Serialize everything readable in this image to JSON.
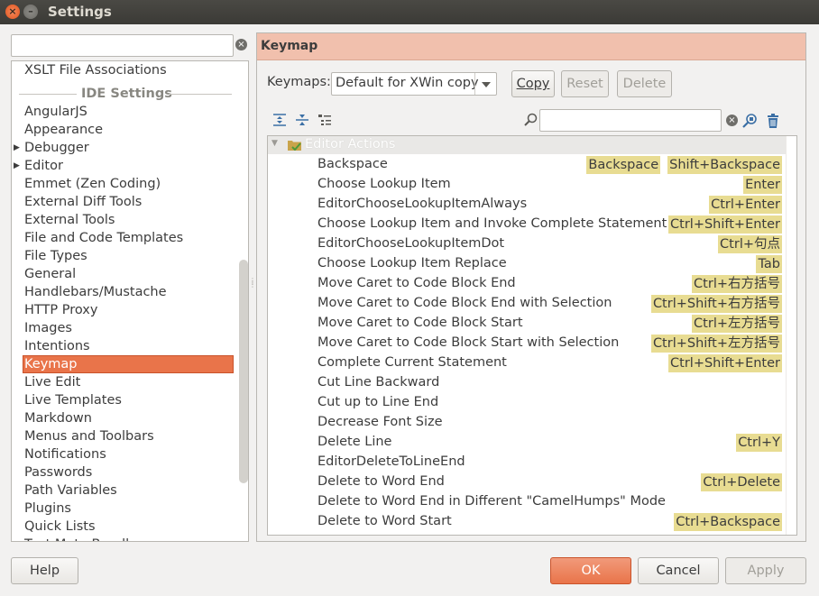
{
  "window": {
    "title": "Settings",
    "close_glyph": "×",
    "minimize_glyph": "–"
  },
  "search": {
    "value": "",
    "clear_glyph": "×"
  },
  "tree": {
    "top_item": "XSLT File Associations",
    "section": "IDE Settings",
    "items": [
      {
        "label": "AngularJS",
        "arrow": ""
      },
      {
        "label": "Appearance",
        "arrow": ""
      },
      {
        "label": "Debugger",
        "arrow": "▶"
      },
      {
        "label": "Editor",
        "arrow": "▶"
      },
      {
        "label": "Emmet (Zen Coding)",
        "arrow": ""
      },
      {
        "label": "External Diff Tools",
        "arrow": ""
      },
      {
        "label": "External Tools",
        "arrow": ""
      },
      {
        "label": "File and Code Templates",
        "arrow": ""
      },
      {
        "label": "File Types",
        "arrow": ""
      },
      {
        "label": "General",
        "arrow": ""
      },
      {
        "label": "Handlebars/Mustache",
        "arrow": ""
      },
      {
        "label": "HTTP Proxy",
        "arrow": ""
      },
      {
        "label": "Images",
        "arrow": ""
      },
      {
        "label": "Intentions",
        "arrow": ""
      },
      {
        "label": "Keymap",
        "arrow": "",
        "selected": true
      },
      {
        "label": "Live Edit",
        "arrow": ""
      },
      {
        "label": "Live Templates",
        "arrow": ""
      },
      {
        "label": "Markdown",
        "arrow": ""
      },
      {
        "label": "Menus and Toolbars",
        "arrow": ""
      },
      {
        "label": "Notifications",
        "arrow": ""
      },
      {
        "label": "Passwords",
        "arrow": ""
      },
      {
        "label": "Path Variables",
        "arrow": ""
      },
      {
        "label": "Plugins",
        "arrow": ""
      },
      {
        "label": "Quick Lists",
        "arrow": ""
      },
      {
        "label": "Text Mate Bundles",
        "arrow": ""
      }
    ]
  },
  "panel": {
    "title": "Keymap",
    "keymaps_label": "Keymaps:",
    "keymap_selected": "Default for XWin copy",
    "copy_label": "Copy",
    "reset_label": "Reset",
    "delete_label": "Delete",
    "filter_value": "",
    "filter_clear_glyph": "×",
    "category": {
      "label": "Editor Actions",
      "tri": "▼"
    },
    "actions": [
      {
        "name": "Backspace",
        "keys": [
          "Backspace",
          "Shift+Backspace"
        ]
      },
      {
        "name": "Choose Lookup Item",
        "keys": [
          "Enter"
        ]
      },
      {
        "name": "EditorChooseLookupItemAlways",
        "keys": [
          "Ctrl+Enter"
        ]
      },
      {
        "name": "Choose Lookup Item and Invoke Complete Statement",
        "keys": [
          "Ctrl+Shift+Enter"
        ]
      },
      {
        "name": "EditorChooseLookupItemDot",
        "keys": [
          "Ctrl+句点"
        ]
      },
      {
        "name": "Choose Lookup Item Replace",
        "keys": [
          "Tab"
        ]
      },
      {
        "name": "Move Caret to Code Block End",
        "keys": [
          "Ctrl+右方括号"
        ]
      },
      {
        "name": "Move Caret to Code Block End with Selection",
        "keys": [
          "Ctrl+Shift+右方括号"
        ]
      },
      {
        "name": "Move Caret to Code Block Start",
        "keys": [
          "Ctrl+左方括号"
        ]
      },
      {
        "name": "Move Caret to Code Block Start with Selection",
        "keys": [
          "Ctrl+Shift+左方括号"
        ]
      },
      {
        "name": "Complete Current Statement",
        "keys": [
          "Ctrl+Shift+Enter"
        ]
      },
      {
        "name": "Cut Line Backward",
        "keys": []
      },
      {
        "name": "Cut up to Line End",
        "keys": []
      },
      {
        "name": "Decrease Font Size",
        "keys": []
      },
      {
        "name": "Delete Line",
        "keys": [
          "Ctrl+Y"
        ]
      },
      {
        "name": "EditorDeleteToLineEnd",
        "keys": []
      },
      {
        "name": "Delete to Word End",
        "keys": [
          "Ctrl+Delete"
        ]
      },
      {
        "name": "Delete to Word End in Different \"CamelHumps\" Mode",
        "keys": []
      },
      {
        "name": "Delete to Word Start",
        "keys": [
          "Ctrl+Backspace"
        ]
      }
    ]
  },
  "footer": {
    "help_label": "Help",
    "ok_label": "OK",
    "cancel_label": "Cancel",
    "apply_label": "Apply"
  },
  "colors": {
    "accent": "#e9744a",
    "header_bg": "#f1c0ad",
    "shortcut_bg": "#e8dc92",
    "titlebar": "#3b3a36"
  }
}
